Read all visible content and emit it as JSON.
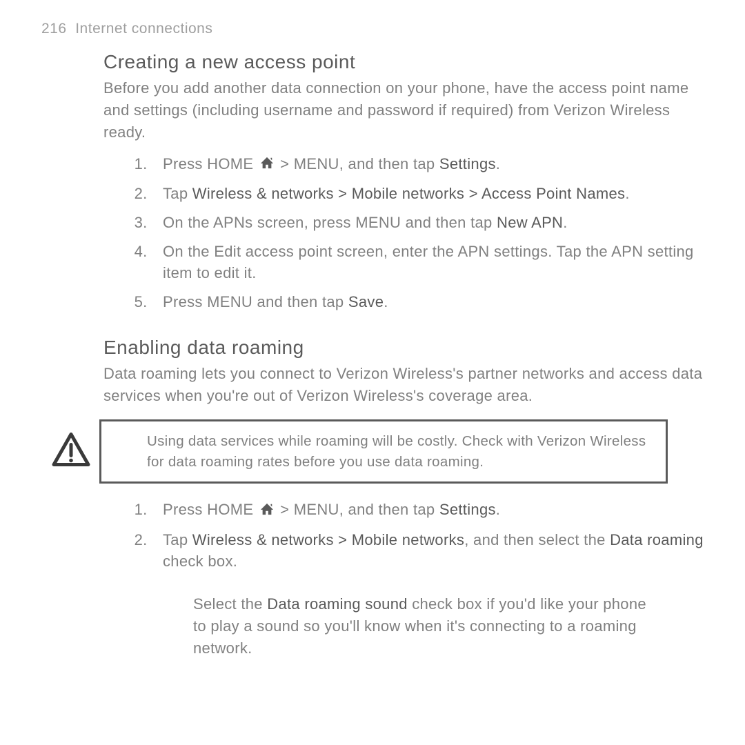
{
  "header": {
    "page_number": "216",
    "chapter": "Internet connections"
  },
  "section1": {
    "title": "Creating a new access point",
    "intro": "Before you add another data connection on your phone, have the access point name and settings (including username and password if required) from Verizon Wireless ready.",
    "steps": {
      "s1_pre": "Press HOME ",
      "s1_post": " > MENU, and then tap ",
      "s1_bold": "Settings",
      "s1_end": ".",
      "s2_pre": "Tap ",
      "s2_bold": "Wireless & networks > Mobile networks > Access Point Names",
      "s2_end": ".",
      "s3_pre": "On the APNs screen, press MENU and then tap ",
      "s3_bold": "New APN",
      "s3_end": ".",
      "s4": "On the Edit access point screen, enter the APN settings. Tap the APN setting item to edit it.",
      "s5_pre": "Press MENU and then tap ",
      "s5_bold": "Save",
      "s5_end": "."
    }
  },
  "section2": {
    "title": "Enabling data roaming",
    "intro": "Data roaming lets you connect to Verizon Wireless's partner networks and access data services when you're out of Verizon Wireless's coverage area.",
    "warning": "Using data services while roaming will be costly. Check with Verizon Wireless for data roaming rates before you use data roaming.",
    "steps": {
      "s1_pre": "Press HOME ",
      "s1_post": " > MENU, and then tap ",
      "s1_bold": "Settings",
      "s1_end": ".",
      "s2_pre": "Tap ",
      "s2_bold1": "Wireless & networks > Mobile networks",
      "s2_mid": ", and then select the ",
      "s2_bold2": "Data roaming",
      "s2_end": " check box.",
      "sub_pre": "Select the ",
      "sub_bold": "Data roaming sound",
      "sub_end": " check box if you'd like your phone to play a sound so you'll know when it's connecting to a roaming network."
    }
  }
}
